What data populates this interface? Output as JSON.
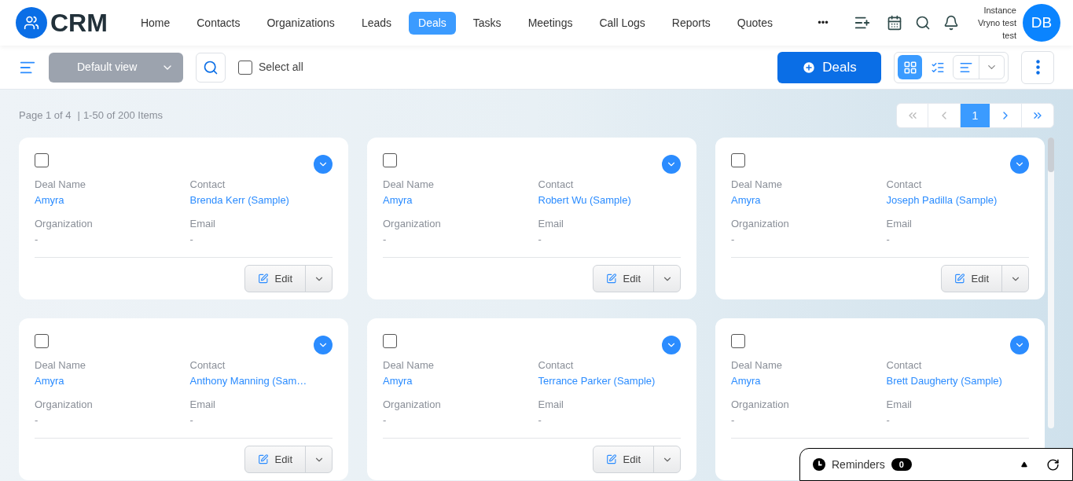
{
  "brand": "CRM",
  "nav": [
    {
      "label": "Home",
      "selected": false
    },
    {
      "label": "Contacts",
      "selected": false
    },
    {
      "label": "Organizations",
      "selected": false
    },
    {
      "label": "Leads",
      "selected": false
    },
    {
      "label": "Deals",
      "selected": true
    },
    {
      "label": "Tasks",
      "selected": false
    },
    {
      "label": "Meetings",
      "selected": false
    },
    {
      "label": "Call Logs",
      "selected": false
    },
    {
      "label": "Reports",
      "selected": false
    },
    {
      "label": "Quotes",
      "selected": false
    }
  ],
  "more": "•••",
  "user": {
    "instance": [
      "Instance",
      "Vryno test",
      "test"
    ],
    "initials": "DB"
  },
  "toolbar": {
    "view": "Default view",
    "select_all": {
      "label": "Select all",
      "checked": false
    },
    "add_button": "Deals",
    "layouts": [
      {
        "kind": "grid",
        "selected": true
      },
      {
        "kind": "list",
        "selected": false
      }
    ]
  },
  "paging": {
    "page": "Page 1 of 4",
    "separator": "|",
    "range": "1-50 of 200 Items",
    "current": "1"
  },
  "cards": [
    {
      "checked": false,
      "fields": [
        {
          "label": "Deal Name",
          "value": "Amyra",
          "link": true
        },
        {
          "label": "Contact",
          "value": "Brenda Kerr (Sample)",
          "link": true
        },
        {
          "label": "Organization",
          "value": "-",
          "link": false
        },
        {
          "label": "Email",
          "value": "-",
          "link": false
        }
      ],
      "edit": "Edit"
    },
    {
      "checked": false,
      "fields": [
        {
          "label": "Deal Name",
          "value": "Amyra",
          "link": true
        },
        {
          "label": "Contact",
          "value": "Robert Wu (Sample)",
          "link": true
        },
        {
          "label": "Organization",
          "value": "-",
          "link": false
        },
        {
          "label": "Email",
          "value": "-",
          "link": false
        }
      ],
      "edit": "Edit"
    },
    {
      "checked": false,
      "fields": [
        {
          "label": "Deal Name",
          "value": "Amyra",
          "link": true
        },
        {
          "label": "Contact",
          "value": "Joseph Padilla (Sample)",
          "link": true
        },
        {
          "label": "Organization",
          "value": "-",
          "link": false
        },
        {
          "label": "Email",
          "value": "-",
          "link": false
        }
      ],
      "edit": "Edit"
    },
    {
      "checked": false,
      "fields": [
        {
          "label": "Deal Name",
          "value": "Amyra",
          "link": true
        },
        {
          "label": "Contact",
          "value": "Anthony Manning (Sam…",
          "link": true
        },
        {
          "label": "Organization",
          "value": "-",
          "link": false
        },
        {
          "label": "Email",
          "value": "-",
          "link": false
        }
      ],
      "edit": "Edit"
    },
    {
      "checked": false,
      "fields": [
        {
          "label": "Deal Name",
          "value": "Amyra",
          "link": true
        },
        {
          "label": "Contact",
          "value": "Terrance Parker (Sample)",
          "link": true
        },
        {
          "label": "Organization",
          "value": "-",
          "link": false
        },
        {
          "label": "Email",
          "value": "-",
          "link": false
        }
      ],
      "edit": "Edit"
    },
    {
      "checked": false,
      "fields": [
        {
          "label": "Deal Name",
          "value": "Amyra",
          "link": true
        },
        {
          "label": "Contact",
          "value": "Brett Daugherty (Sample)",
          "link": true
        },
        {
          "label": "Organization",
          "value": "-",
          "link": false
        },
        {
          "label": "Email",
          "value": "-",
          "link": false
        }
      ]
    }
  ],
  "reminders": {
    "label": "Reminders",
    "count": "0"
  }
}
